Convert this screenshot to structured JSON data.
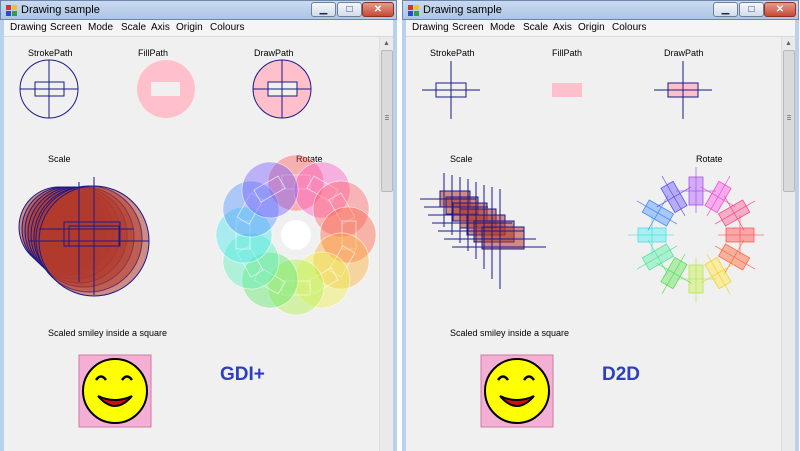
{
  "left": {
    "title": "Drawing sample",
    "menu": [
      "Drawing",
      "Screen",
      "Mode",
      "Scale",
      "Axis",
      "Origin",
      "Colours"
    ],
    "labels": {
      "stroke": "StrokePath",
      "fill": "FillPath",
      "draw": "DrawPath",
      "scale": "Scale",
      "rotate": "Rotate",
      "smiley": "Scaled smiley inside a square"
    },
    "renderer": "GDI+"
  },
  "right": {
    "title": "Drawing sample",
    "menu": [
      "Drawing",
      "Screen",
      "Mode",
      "Scale",
      "Axis",
      "Origin",
      "Colours"
    ],
    "labels": {
      "stroke": "StrokePath",
      "fill": "FillPath",
      "draw": "DrawPath",
      "scale": "Scale",
      "rotate": "Rotate",
      "smiley": "Scaled smiley inside a square"
    },
    "renderer": "D2D"
  },
  "colors": {
    "stroke": "#1a1a8c",
    "pink": "#ffc0cb",
    "scale_fill": "#b03a2e",
    "renderer_text": "#2c3fc0",
    "title_bar": "#b9d1ea"
  },
  "icons": {
    "minimize": "minimize-icon",
    "maximize": "maximize-icon",
    "close": "close-icon"
  }
}
